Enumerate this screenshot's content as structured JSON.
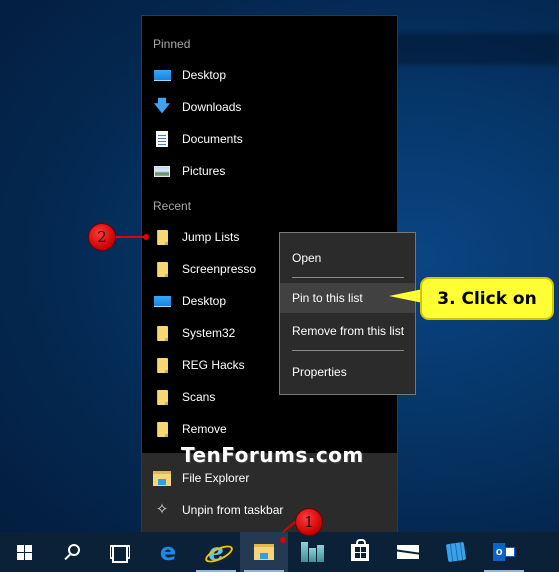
{
  "jumplist": {
    "pinned_title": "Pinned",
    "pinned": [
      {
        "label": "Desktop",
        "icon": "desktop-icon"
      },
      {
        "label": "Downloads",
        "icon": "download-arrow-icon"
      },
      {
        "label": "Documents",
        "icon": "documents-icon"
      },
      {
        "label": "Pictures",
        "icon": "pictures-icon"
      }
    ],
    "recent_title": "Recent",
    "recent": [
      {
        "label": "Jump Lists",
        "icon": "folder-icon"
      },
      {
        "label": "Screenpresso",
        "icon": "folder-icon"
      },
      {
        "label": "Desktop",
        "icon": "desktop-icon"
      },
      {
        "label": "System32",
        "icon": "folder-icon"
      },
      {
        "label": "REG Hacks",
        "icon": "folder-icon"
      },
      {
        "label": "Scans",
        "icon": "folder-icon"
      },
      {
        "label": "Remove",
        "icon": "folder-icon"
      }
    ],
    "tasks": [
      {
        "label": "File Explorer",
        "icon": "file-explorer-icon"
      },
      {
        "label": "Unpin from taskbar",
        "icon": "unpin-icon"
      }
    ]
  },
  "watermark": "TenForums.com",
  "context_menu": {
    "items": [
      "Open",
      "Pin to this list",
      "Remove from this list",
      "Properties"
    ],
    "highlighted": "Pin to this list"
  },
  "callout": {
    "text": "3. Click on"
  },
  "badges": {
    "step1": "1",
    "step2": "2"
  },
  "taskbar": {
    "buttons": [
      {
        "name": "start",
        "icon": "windows-logo-icon"
      },
      {
        "name": "search",
        "icon": "search-icon"
      },
      {
        "name": "task-view",
        "icon": "task-view-icon"
      },
      {
        "name": "edge",
        "icon": "edge-icon"
      },
      {
        "name": "internet-explorer",
        "icon": "internet-explorer-icon"
      },
      {
        "name": "file-explorer",
        "icon": "file-explorer-icon"
      },
      {
        "name": "buildings-app",
        "icon": "buildings-icon"
      },
      {
        "name": "store",
        "icon": "store-icon"
      },
      {
        "name": "mail",
        "icon": "mail-icon"
      },
      {
        "name": "registry-editor",
        "icon": "registry-cubes-icon"
      },
      {
        "name": "outlook",
        "icon": "outlook-icon"
      }
    ],
    "outlook_glyph": "o"
  },
  "colors": {
    "callout_bg": "#ffff33",
    "badge_red": "#e00000",
    "menu_bg": "#2b2b2b",
    "jumplist_bg": "#000000",
    "taskbar_bg": "#0b2137"
  }
}
